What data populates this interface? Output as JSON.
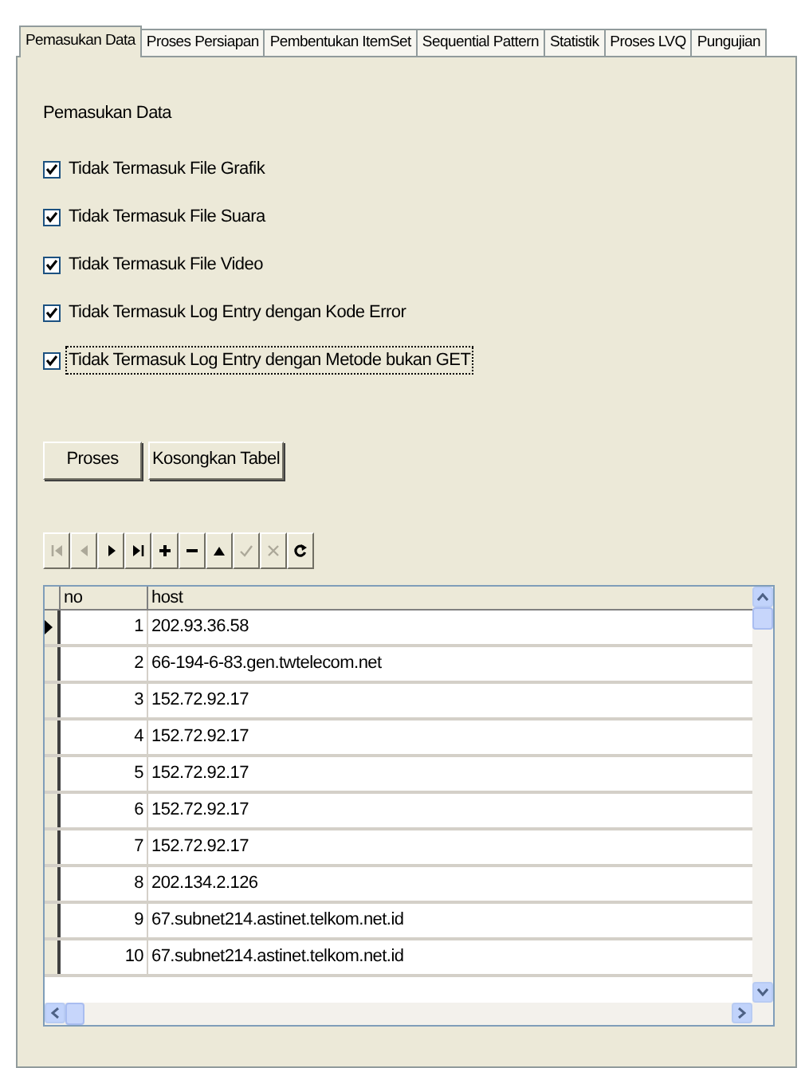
{
  "tabs": [
    {
      "label": "Pemasukan Data",
      "selected": true
    },
    {
      "label": "Proses Persiapan",
      "selected": false
    },
    {
      "label": "Pembentukan ItemSet",
      "selected": false
    },
    {
      "label": "Sequential Pattern",
      "selected": false
    },
    {
      "label": "Statistik",
      "selected": false
    },
    {
      "label": "Proses LVQ",
      "selected": false
    },
    {
      "label": "Pungujian",
      "selected": false
    }
  ],
  "section_label": "Pemasukan Data",
  "checkboxes": [
    {
      "label": "Tidak Termasuk File Grafik",
      "checked": true,
      "focused": false
    },
    {
      "label": "Tidak Termasuk File Suara",
      "checked": true,
      "focused": false
    },
    {
      "label": "Tidak Termasuk File Video",
      "checked": true,
      "focused": false
    },
    {
      "label": "Tidak Termasuk Log Entry dengan Kode Error",
      "checked": true,
      "focused": false
    },
    {
      "label": "Tidak Termasuk Log Entry dengan Metode bukan GET",
      "checked": true,
      "focused": true
    }
  ],
  "buttons": [
    "Proses",
    "Kosongkan Tabel"
  ],
  "navigator": [
    {
      "kind": "first",
      "disabled": true
    },
    {
      "kind": "prior",
      "disabled": true
    },
    {
      "kind": "next",
      "disabled": false
    },
    {
      "kind": "last",
      "disabled": false
    },
    {
      "kind": "insert",
      "disabled": false
    },
    {
      "kind": "delete",
      "disabled": false
    },
    {
      "kind": "edit",
      "disabled": false
    },
    {
      "kind": "post",
      "disabled": true
    },
    {
      "kind": "cancel",
      "disabled": true
    },
    {
      "kind": "refresh",
      "disabled": false
    }
  ],
  "grid": {
    "columns": [
      "no",
      "host"
    ],
    "rows": [
      {
        "no": "1",
        "host": "202.93.36.58",
        "current": true
      },
      {
        "no": "2",
        "host": "66-194-6-83.gen.twtelecom.net",
        "current": false
      },
      {
        "no": "3",
        "host": "152.72.92.17",
        "current": false
      },
      {
        "no": "4",
        "host": "152.72.92.17",
        "current": false
      },
      {
        "no": "5",
        "host": "152.72.92.17",
        "current": false
      },
      {
        "no": "6",
        "host": "152.72.92.17",
        "current": false
      },
      {
        "no": "7",
        "host": "152.72.92.17",
        "current": false
      },
      {
        "no": "8",
        "host": "202.134.2.126",
        "current": false
      },
      {
        "no": "9",
        "host": "67.subnet214.astinet.telkom.net.id",
        "current": false
      },
      {
        "no": "10",
        "host": "67.subnet214.astinet.telkom.net.id",
        "current": false
      }
    ]
  }
}
